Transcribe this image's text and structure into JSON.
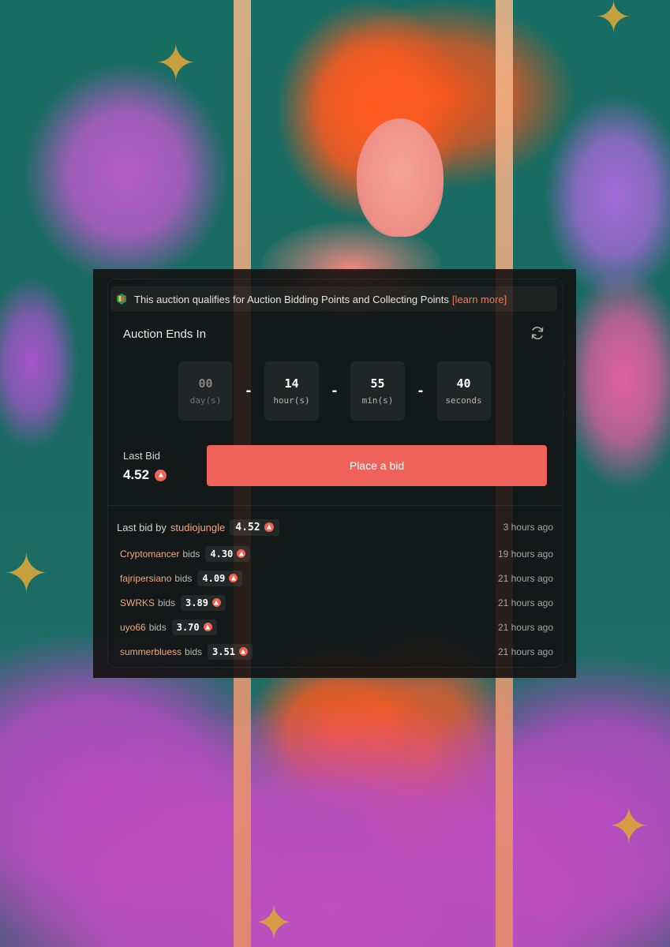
{
  "notice": {
    "text": "This auction qualifies for Auction Bidding Points and Collecting Points",
    "link": "[learn more]"
  },
  "countdown": {
    "title": "Auction Ends In",
    "units": [
      {
        "value": "00",
        "label": "day(s)"
      },
      {
        "value": "14",
        "label": "hour(s)"
      },
      {
        "value": "55",
        "label": "min(s)"
      },
      {
        "value": "40",
        "label": "seconds"
      }
    ],
    "separator": "-"
  },
  "last_bid": {
    "label": "Last Bid",
    "value": "4.52"
  },
  "place_bid_button": "Place a bid",
  "history": {
    "top": {
      "prefix": "Last bid by",
      "bidder": "studiojungle",
      "amount": "4.52",
      "time": "3 hours ago"
    },
    "bids_word": "bids",
    "rows": [
      {
        "bidder": "Cryptomancer",
        "amount": "4.30",
        "time": "19 hours ago"
      },
      {
        "bidder": "fajripersiano",
        "amount": "4.09",
        "time": "21 hours ago"
      },
      {
        "bidder": "SWRKS",
        "amount": "3.89",
        "time": "21 hours ago"
      },
      {
        "bidder": "uyo66",
        "amount": "3.70",
        "time": "21 hours ago"
      },
      {
        "bidder": "summerbluess",
        "amount": "3.51",
        "time": "21 hours ago"
      }
    ]
  },
  "colors": {
    "accent": "#ef625a",
    "bidder_name": "#f3a77e",
    "link": "#f0795c",
    "panel_bg": "#120e0e"
  },
  "icons": {
    "notice_badge": "points-badge-icon",
    "refresh": "refresh-icon",
    "currency": "currency-icon"
  }
}
